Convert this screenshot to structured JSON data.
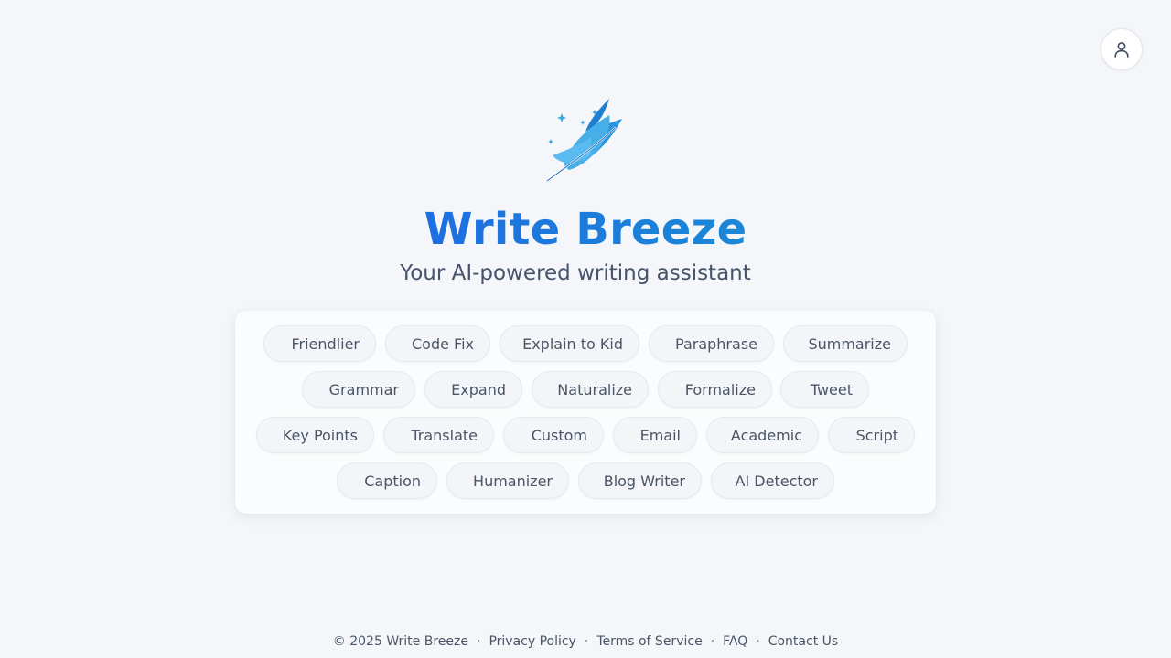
{
  "brand": {
    "title": "Write Breeze",
    "subtitle": "Your AI-powered writing assistant",
    "logo_icon": "feather-icon",
    "accent_color": "#1e6fe0"
  },
  "header": {
    "profile_icon": "user-icon"
  },
  "tools": [
    "Friendlier",
    "Code Fix",
    "Explain to Kid",
    "Paraphrase",
    "Summarize",
    "Grammar",
    "Expand",
    "Naturalize",
    "Formalize",
    "Tweet",
    "Key Points",
    "Translate",
    "Custom",
    "Email",
    "Academic",
    "Script",
    "Caption",
    "Humanizer",
    "Blog Writer",
    "AI Detector"
  ],
  "footer": {
    "copyright": "© 2025 Write Breeze",
    "links": [
      "Privacy Policy",
      "Terms of Service",
      "FAQ",
      "Contact Us"
    ]
  }
}
